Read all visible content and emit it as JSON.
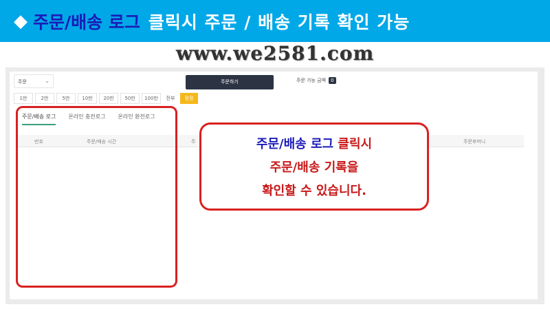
{
  "banner": {
    "diamond": "◆",
    "highlight": "주문/배송 로그",
    "rest": "클릭시 주문 / 배송 기록 확인 가능",
    "colors": {
      "background": "#00a8e8",
      "highlight": "#1b1bb8",
      "text": "#ffffff"
    }
  },
  "domain": "www.we2581.com",
  "form": {
    "select_value": "주문",
    "order_button": "주문하기",
    "available_label": "주문 가능 금액",
    "available_value": "0",
    "amounts": [
      "1만",
      "2만",
      "5만",
      "10만",
      "20만",
      "50만",
      "100만"
    ],
    "all_label": "전부",
    "reset_label": "정정"
  },
  "tabs": [
    "주문/배송 로그",
    "온라인 충전로그",
    "온라인 환전로그"
  ],
  "table": {
    "col_number": "번호",
    "col_time": "주문/배송 시간",
    "col_partial": "주",
    "col_money": "주문후머니"
  },
  "callout": {
    "line1_blue": "주문/배송 로그",
    "line1_red": "클릭시",
    "line2": "주문/배송 기록을",
    "line3": "확인할 수 있습니다."
  },
  "colors": {
    "accent_red": "#d92020",
    "reset_yellow": "#f5b81c",
    "dark_button": "#2c3443"
  }
}
